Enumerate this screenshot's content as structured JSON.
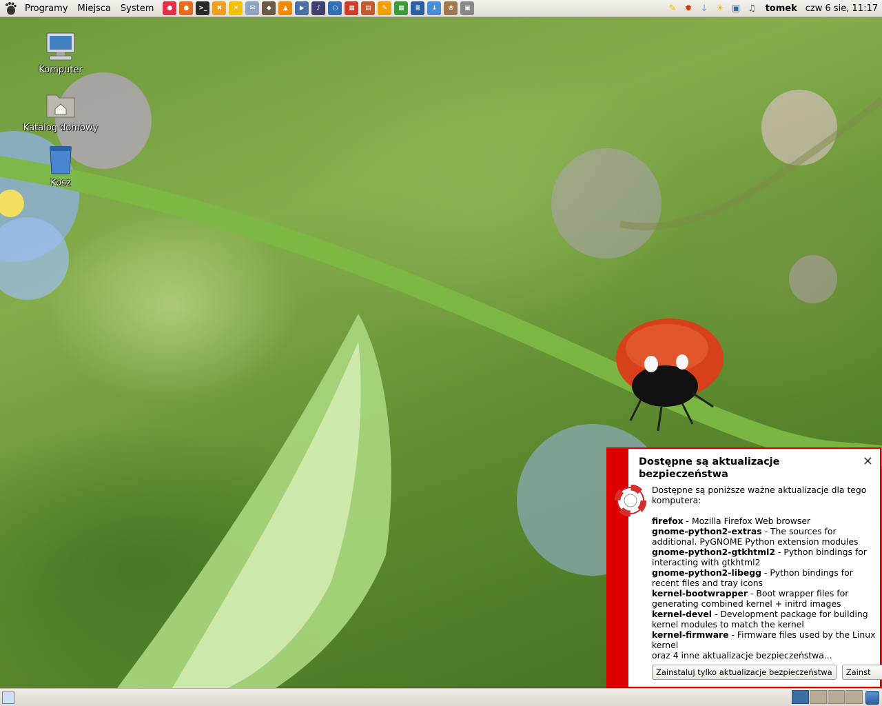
{
  "top_panel": {
    "menus": [
      "Programy",
      "Miejsca",
      "System"
    ],
    "launchers": [
      {
        "icon": "openoffice-icon",
        "glyph": "●",
        "color": "#e0304a"
      },
      {
        "icon": "firefox-icon",
        "glyph": "●",
        "color": "#e66b1c"
      },
      {
        "icon": "terminal-icon",
        "glyph": ">_",
        "color": "#2b2b2b"
      },
      {
        "icon": "tools-icon",
        "glyph": "✖",
        "color": "#f0a020"
      },
      {
        "icon": "weather-sun-icon",
        "glyph": "☀",
        "color": "#f2c200"
      },
      {
        "icon": "mail-icon",
        "glyph": "✉",
        "color": "#8fa4bf"
      },
      {
        "icon": "gimp-icon",
        "glyph": "◆",
        "color": "#6b5b45"
      },
      {
        "icon": "vlc-icon",
        "glyph": "▲",
        "color": "#f28a00"
      },
      {
        "icon": "mplayer-icon",
        "glyph": "▶",
        "color": "#4a6fa5"
      },
      {
        "icon": "mms-icon",
        "glyph": "♪",
        "color": "#404070"
      },
      {
        "icon": "globe-icon",
        "glyph": "○",
        "color": "#2f6fb5"
      },
      {
        "icon": "presentation-icon",
        "glyph": "▦",
        "color": "#d03a2a"
      },
      {
        "icon": "database-icon",
        "glyph": "▤",
        "color": "#c05a30"
      },
      {
        "icon": "draw-icon",
        "glyph": "✎",
        "color": "#f0a000"
      },
      {
        "icon": "spreadsheet-icon",
        "glyph": "▦",
        "color": "#3b9a3b"
      },
      {
        "icon": "writer-icon",
        "glyph": "≣",
        "color": "#2a5ea5"
      },
      {
        "icon": "download-icon",
        "glyph": "↓",
        "color": "#4a8fd6"
      },
      {
        "icon": "bunny-icon",
        "glyph": "❀",
        "color": "#a07850"
      },
      {
        "icon": "disk-icon",
        "glyph": "▣",
        "color": "#888888"
      }
    ],
    "tray": [
      {
        "icon": "notes-icon",
        "glyph": "✎",
        "color": "#e8c200"
      },
      {
        "icon": "update-alert-icon",
        "glyph": "✹",
        "color": "#e03000"
      },
      {
        "icon": "download-arrow-icon",
        "glyph": "↓",
        "color": "#6aa0e0"
      },
      {
        "icon": "weather-icon",
        "glyph": "☀",
        "color": "#e8b800"
      },
      {
        "icon": "network-icon",
        "glyph": "▣",
        "color": "#3a6ea5"
      },
      {
        "icon": "volume-icon",
        "glyph": "♫",
        "color": "#555555"
      }
    ],
    "username": "tomek",
    "clock": "czw  6 sie, 11:17"
  },
  "desktop": {
    "icons": [
      {
        "label": "Komputer",
        "icon": "computer-icon"
      },
      {
        "label": "Katalog domowy",
        "icon": "home-folder-icon"
      },
      {
        "label": "Kosz",
        "icon": "trash-icon"
      }
    ]
  },
  "notification": {
    "title": "Dostępne są aktualizacje bezpieczeństwa",
    "intro": "Dostępne są poniższe ważne aktualizacje dla tego komputera:",
    "packages": [
      {
        "name": "firefox",
        "desc": " - Mozilla Firefox Web browser"
      },
      {
        "name": "gnome-python2-extras",
        "desc": " - The sources for additional. PyGNOME Python extension modules"
      },
      {
        "name": "gnome-python2-gtkhtml2",
        "desc": " - Python bindings for interacting with gtkhtml2"
      },
      {
        "name": "gnome-python2-libegg",
        "desc": " - Python bindings for recent files and tray icons"
      },
      {
        "name": "kernel-bootwrapper",
        "desc": " - Boot wrapper files for generating combined kernel + initrd images"
      },
      {
        "name": "kernel-devel",
        "desc": " - Development package for building kernel modules to match the kernel"
      },
      {
        "name": "kernel-firmware",
        "desc": " - Firmware files used by the Linux kernel"
      }
    ],
    "more": "oraz 4 inne aktualizacje bezpieczeństwa...",
    "button_security_only": "Zainstaluj tylko aktualizacje bezpieczeństwa",
    "button_all": "Zainst",
    "accent_color": "#dd0000"
  },
  "bottom_panel": {
    "workspace_count": 4,
    "active_workspace": 1
  }
}
